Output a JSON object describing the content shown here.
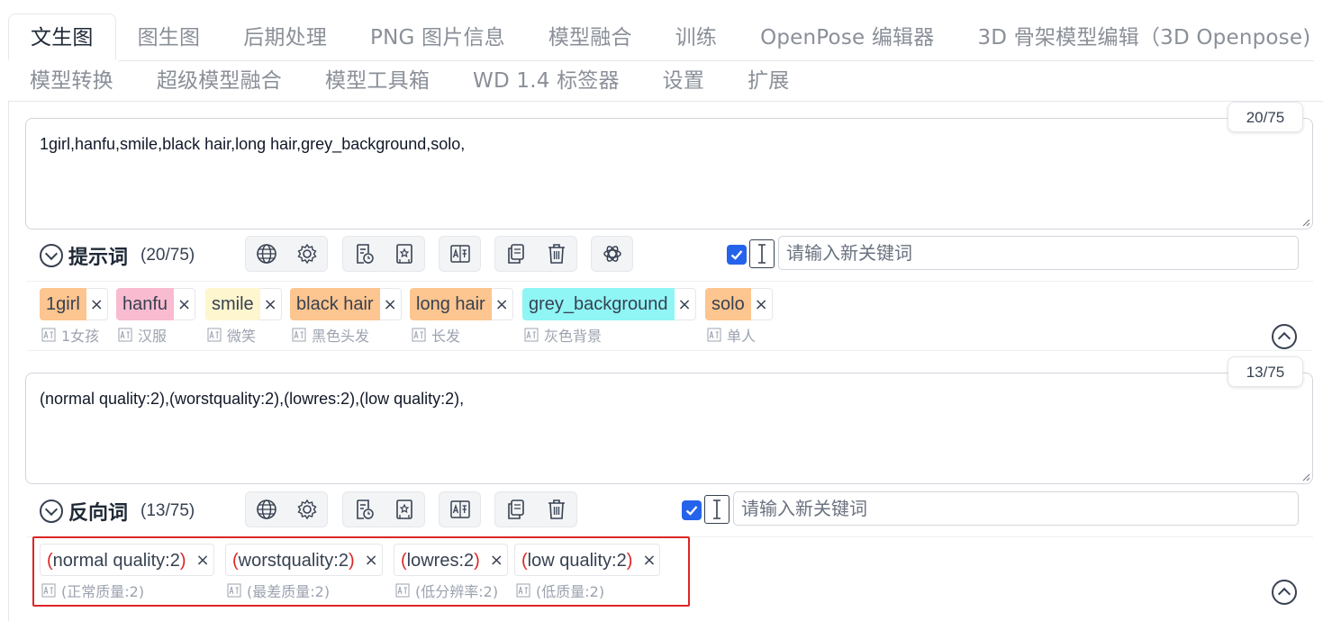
{
  "tabs_row1": [
    "文生图",
    "图生图",
    "后期处理",
    "PNG 图片信息",
    "模型融合",
    "训练",
    "OpenPose 编辑器",
    "3D 骨架模型编辑（3D Openpose)"
  ],
  "tabs_row2": [
    "模型转换",
    "超级模型融合",
    "模型工具箱",
    "WD 1.4 标签器",
    "设置",
    "扩展"
  ],
  "positive": {
    "prompt_text": "1girl,hanfu,smile,black hair,long hair,grey_background,solo,",
    "counter": "20/75",
    "section_title": "提示词",
    "section_count": "(20/75)",
    "keyword_placeholder": "请输入新关键词",
    "tags": [
      {
        "label": "1girl",
        "translation": "1女孩",
        "color": "#fdc58f"
      },
      {
        "label": "hanfu",
        "translation": "汉服",
        "color": "#f8bbd0"
      },
      {
        "label": "smile",
        "translation": "微笑",
        "color": "#fdf6cf"
      },
      {
        "label": "black hair",
        "translation": "黑色头发",
        "color": "#fdc58f"
      },
      {
        "label": "long hair",
        "translation": "长发",
        "color": "#fdc58f"
      },
      {
        "label": "grey_background",
        "translation": "灰色背景",
        "color": "#8ff5f5"
      },
      {
        "label": "solo",
        "translation": "单人",
        "color": "#fdc58f"
      }
    ]
  },
  "negative": {
    "prompt_text": "(normal quality:2),(worstquality:2),(lowres:2),(low quality:2),",
    "counter": "13/75",
    "section_title": "反向词",
    "section_count": "(13/75)",
    "keyword_placeholder": "请输入新关键词",
    "tags": [
      {
        "label": "normal quality:2",
        "translation": "(正常质量:2)"
      },
      {
        "label": "worstquality:2",
        "translation": "(最差质量:2)"
      },
      {
        "label": "lowres:2",
        "translation": "(低分辨率:2)"
      },
      {
        "label": "low quality:2",
        "translation": "(低质量:2)"
      }
    ]
  },
  "close_glyph": "×",
  "paren_open": "(",
  "paren_close": ")",
  "icons": [
    "globe-icon",
    "gear-icon",
    "history-icon",
    "bookmark-icon",
    "translate-icon",
    "copy-icon",
    "trash-icon",
    "openai-icon",
    "text-cursor-icon",
    "check-icon",
    "collapse-icon"
  ]
}
